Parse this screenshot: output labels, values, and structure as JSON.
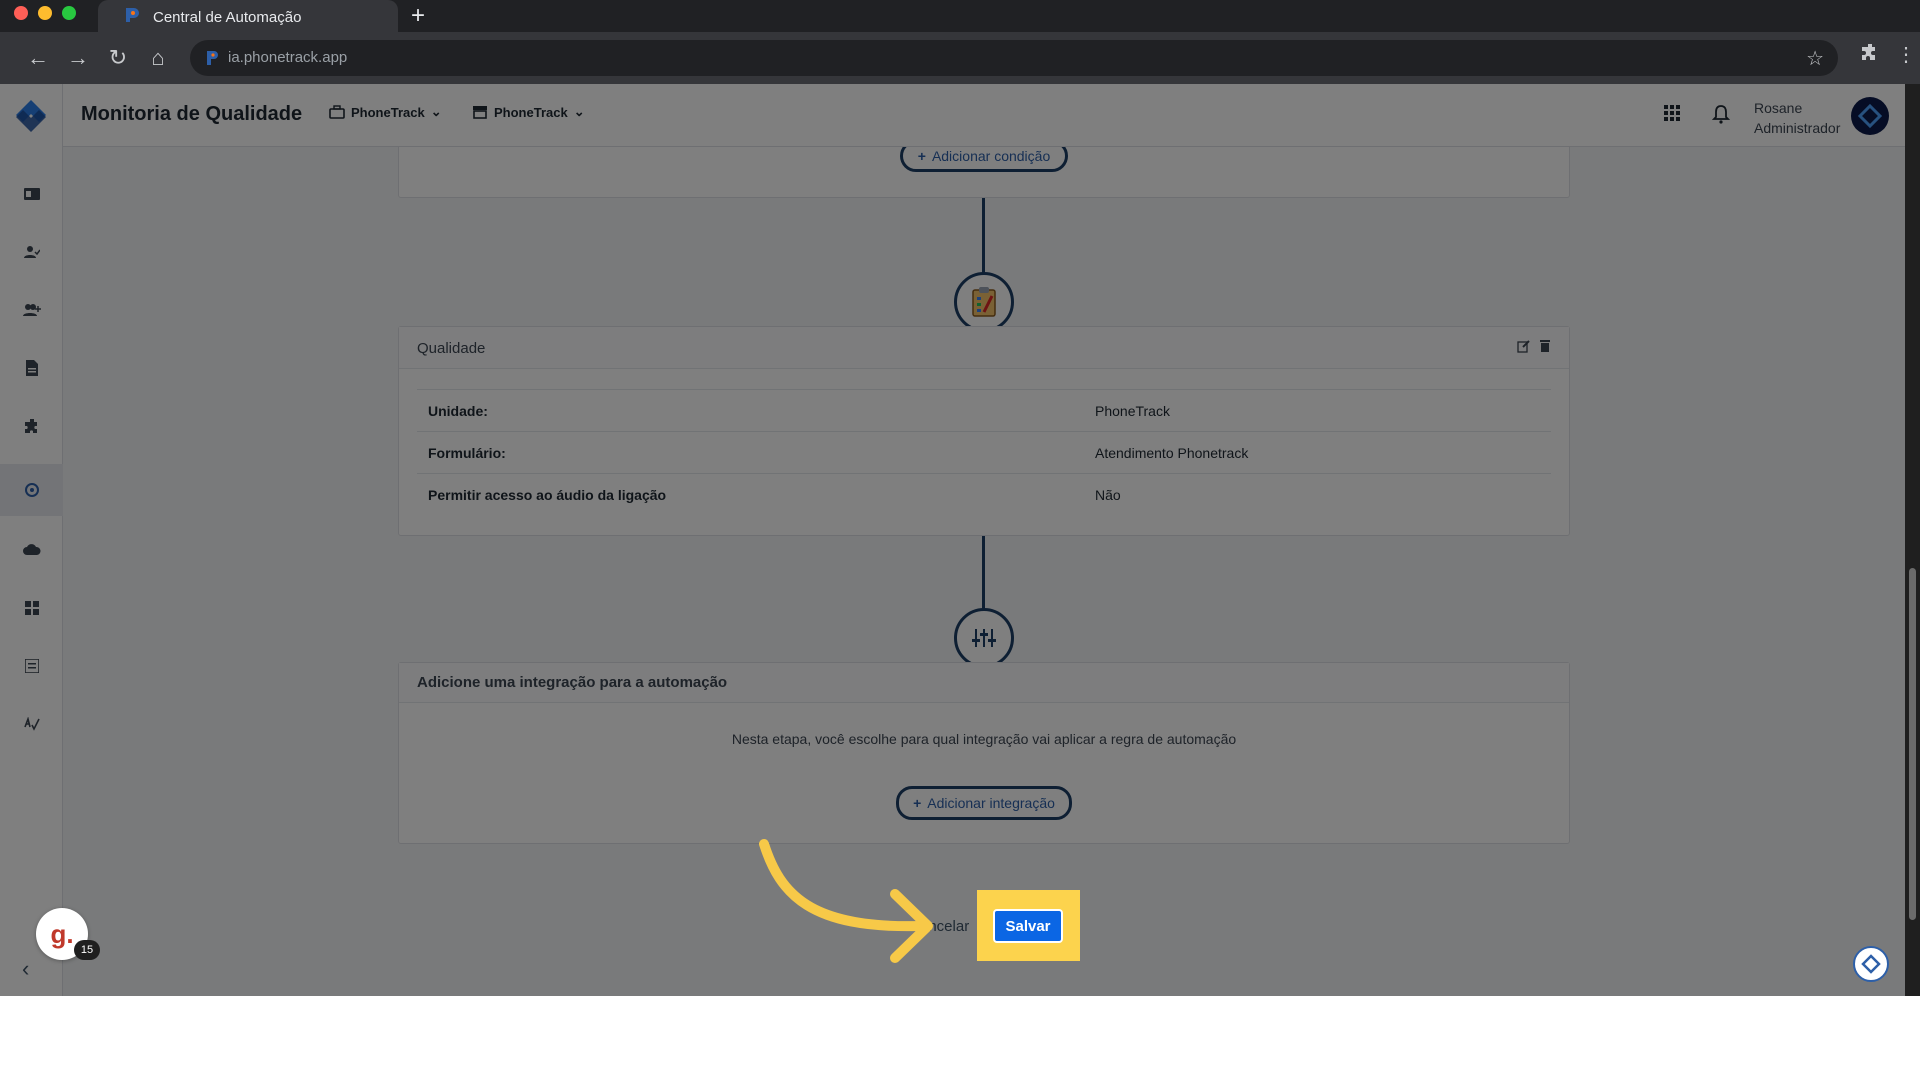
{
  "browser": {
    "tab_title": "Central de Automação",
    "new_tab_symbol": "+",
    "url": "ia.phonetrack.app"
  },
  "header": {
    "page_title": "Monitoria de Qualidade",
    "company_selector": "PhoneTrack",
    "unit_selector": "PhoneTrack",
    "user_name": "Rosane",
    "user_role": "Administrador"
  },
  "sidebar": {
    "icons": [
      "id-card-icon",
      "user-check-icon",
      "users-plus-icon",
      "document-icon",
      "puzzle-icon",
      "automation-icon",
      "cloud-upload-icon",
      "dashboard-icon",
      "list-icon",
      "signature-icon"
    ],
    "active_index": 5
  },
  "condition_card": {
    "add_condition_label": "Adicionar condição"
  },
  "quality_card": {
    "title": "Qualidade",
    "rows": [
      {
        "key": "Unidade:",
        "value": "PhoneTrack"
      },
      {
        "key": "Formulário:",
        "value": "Atendimento Phonetrack"
      },
      {
        "key": "Permitir acesso ao áudio da ligação",
        "value": "Não"
      }
    ]
  },
  "integration_card": {
    "title": "Adicione uma integração para a automação",
    "description": "Nesta etapa, você escolhe para qual integração vai aplicar a regra de automação",
    "add_integration_label": "Adicionar integração"
  },
  "actions": {
    "cancel_label": "ancelar",
    "save_label": "Salvar"
  },
  "help": {
    "letter": "g.",
    "badge_count": "15"
  },
  "colors": {
    "accent": "#0b66e4",
    "highlight": "#fcd34d",
    "arrow": "#f7c948",
    "connector": "#1d3f66"
  }
}
